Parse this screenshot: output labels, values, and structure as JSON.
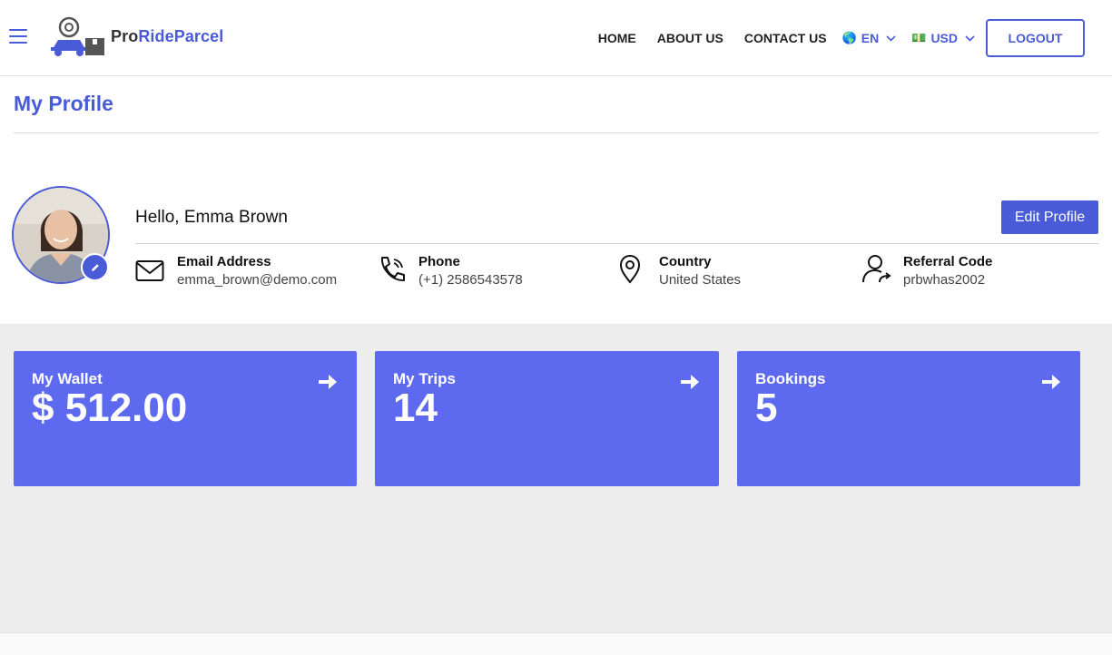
{
  "brand": {
    "name_prefix": "Pro",
    "name_suffix": "RideParcel"
  },
  "nav": {
    "links": [
      "HOME",
      "ABOUT US",
      "CONTACT US"
    ],
    "language": {
      "flag": "🌎",
      "value": "EN"
    },
    "currency": {
      "flag": "💵",
      "value": "USD"
    },
    "logout_label": "LOGOUT"
  },
  "profile": {
    "page_title": "My Profile",
    "greeting": "Hello, Emma Brown",
    "edit_button": "Edit Profile",
    "details": [
      {
        "label": "Email Address",
        "value": "emma_brown@demo.com",
        "icon": "envelope-icon"
      },
      {
        "label": "Phone",
        "value": "(+1) 2586543578",
        "icon": "phone-icon"
      },
      {
        "label": "Country",
        "value": "United States",
        "icon": "location-pin-icon"
      },
      {
        "label": "Referral Code",
        "value": "prbwhas2002",
        "icon": "user-share-icon"
      }
    ]
  },
  "cards": [
    {
      "title": "My Wallet",
      "value": "$ 512.00"
    },
    {
      "title": "My Trips",
      "value": "14"
    },
    {
      "title": "Bookings",
      "value": "5"
    }
  ],
  "colors": {
    "accent": "#4a5bd8",
    "card": "#5d6af0",
    "background": "#ededed"
  }
}
